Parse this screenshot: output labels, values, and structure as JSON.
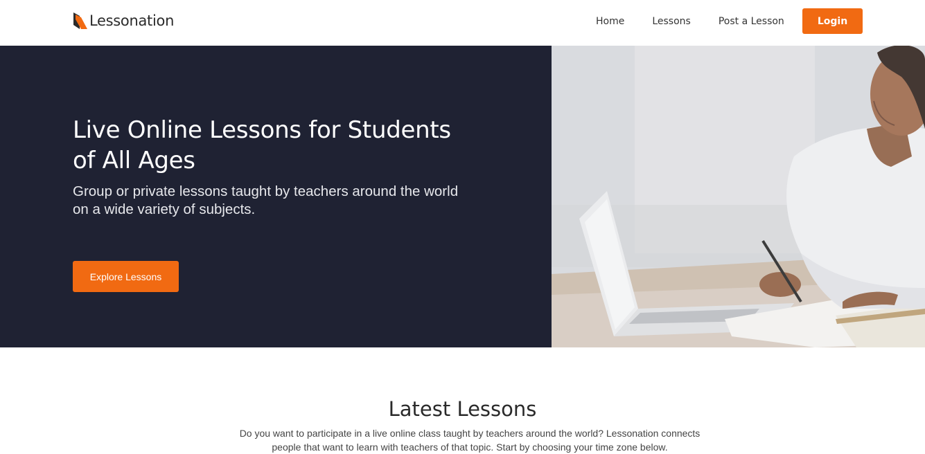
{
  "brand": {
    "name": "Lessonation",
    "logo_icon": "book-logo-icon",
    "accent_color": "#f16a12",
    "logo_dark_color": "#2b2b2b"
  },
  "nav": {
    "items": [
      {
        "label": "Home"
      },
      {
        "label": "Lessons"
      },
      {
        "label": "Post a Lesson"
      }
    ],
    "login_label": "Login"
  },
  "hero": {
    "title": "Live Online Lessons for Students of All Ages",
    "subtitle": "Group or private lessons taught by teachers around the world on a wide variety of subjects.",
    "cta_label": "Explore Lessons",
    "background_color": "#1f2233"
  },
  "latest": {
    "title": "Latest Lessons",
    "description": "Do you want to participate in a live online class taught by teachers around the world? Lessonation connects people that want to learn with teachers of that topic. Start by choosing your time zone below."
  }
}
